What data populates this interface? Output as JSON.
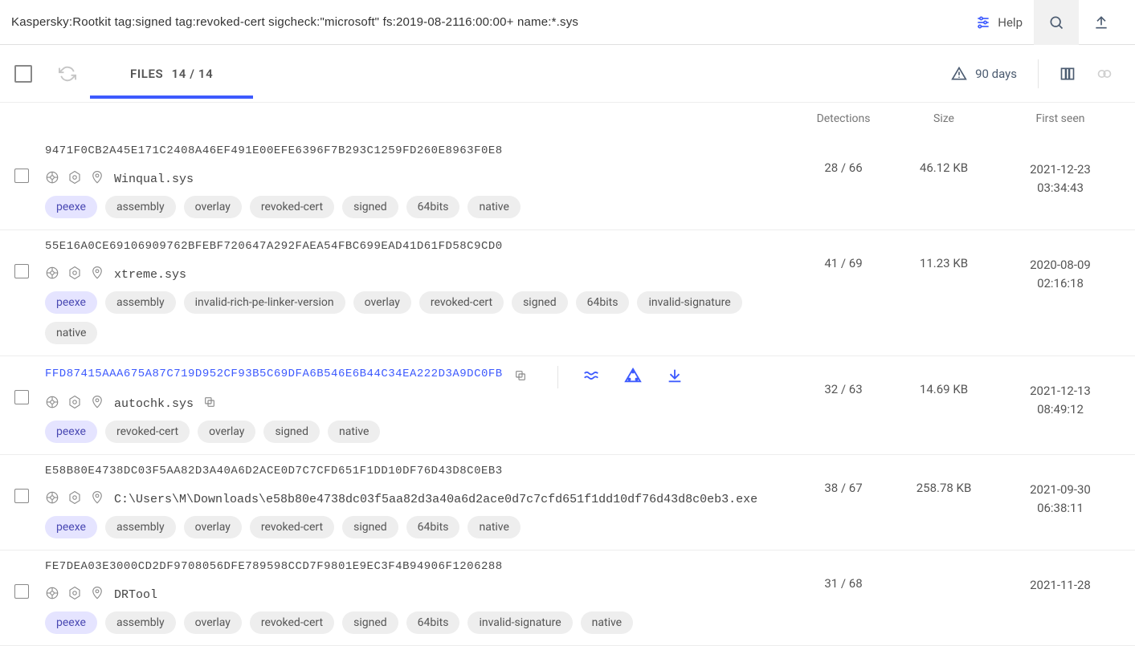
{
  "search": {
    "query": "Kaspersky:Rootkit tag:signed tag:revoked-cert sigcheck:\"microsoft\" fs:2019-08-2116:00:00+ name:*.sys"
  },
  "top": {
    "help": "Help"
  },
  "tab": {
    "label": "FILES",
    "count": "14 / 14"
  },
  "header_right": {
    "days": "90 days"
  },
  "columns": {
    "detections": "Detections",
    "size": "Size",
    "first_seen": "First seen"
  },
  "rows": [
    {
      "hash": "9471F0CB2A45E171C2408A46EF491E00EFE6396F7B293C1259FD260E8963F0E8",
      "hash_is_link": false,
      "filename": "Winqual.sys",
      "has_copy_name": false,
      "show_row_actions": false,
      "tags": [
        "peexe",
        "assembly",
        "overlay",
        "revoked-cert",
        "signed",
        "64bits",
        "native"
      ],
      "detections": "28 / 66",
      "size": "46.12 KB",
      "first_seen_line1": "2021-12-23",
      "first_seen_line2": "03:34:43"
    },
    {
      "hash": "55E16A0CE69106909762BFEBF720647A292FAEA54FBC699EAD41D61FD58C9CD0",
      "hash_is_link": false,
      "filename": "xtreme.sys",
      "has_copy_name": false,
      "show_row_actions": false,
      "tags": [
        "peexe",
        "assembly",
        "invalid-rich-pe-linker-version",
        "overlay",
        "revoked-cert",
        "signed",
        "64bits",
        "invalid-signature",
        "native"
      ],
      "detections": "41 / 69",
      "size": "11.23 KB",
      "first_seen_line1": "2020-08-09",
      "first_seen_line2": "02:16:18"
    },
    {
      "hash": "FFD87415AAA675A87C719D952CF93B5C69DFA6B546E6B44C34EA222D3A9DC0FB",
      "hash_is_link": true,
      "filename": "autochk.sys",
      "has_copy_name": true,
      "show_row_actions": true,
      "tags": [
        "peexe",
        "revoked-cert",
        "overlay",
        "signed",
        "native"
      ],
      "detections": "32 / 63",
      "size": "14.69 KB",
      "first_seen_line1": "2021-12-13",
      "first_seen_line2": "08:49:12"
    },
    {
      "hash": "E58B80E4738DC03F5AA82D3A40A6D2ACE0D7C7CFD651F1DD10DF76D43D8C0EB3",
      "hash_is_link": false,
      "filename": "C:\\Users\\M\\Downloads\\e58b80e4738dc03f5aa82d3a40a6d2ace0d7c7cfd651f1dd10df76d43d8c0eb3.exe",
      "has_copy_name": false,
      "show_row_actions": false,
      "tags": [
        "peexe",
        "assembly",
        "overlay",
        "revoked-cert",
        "signed",
        "64bits",
        "native"
      ],
      "detections": "38 / 67",
      "size": "258.78 KB",
      "first_seen_line1": "2021-09-30",
      "first_seen_line2": "06:38:11"
    },
    {
      "hash": "FE7DEA03E3000CD2DF9708056DFE789598CCD7F9801E9EC3F4B94906F1206288",
      "hash_is_link": false,
      "filename": "DRTool",
      "has_copy_name": false,
      "show_row_actions": false,
      "tags": [
        "peexe",
        "assembly",
        "overlay",
        "revoked-cert",
        "signed",
        "64bits",
        "invalid-signature",
        "native"
      ],
      "detections": "31 / 68",
      "size": "",
      "first_seen_line1": "2021-11-28",
      "first_seen_line2": ""
    }
  ]
}
